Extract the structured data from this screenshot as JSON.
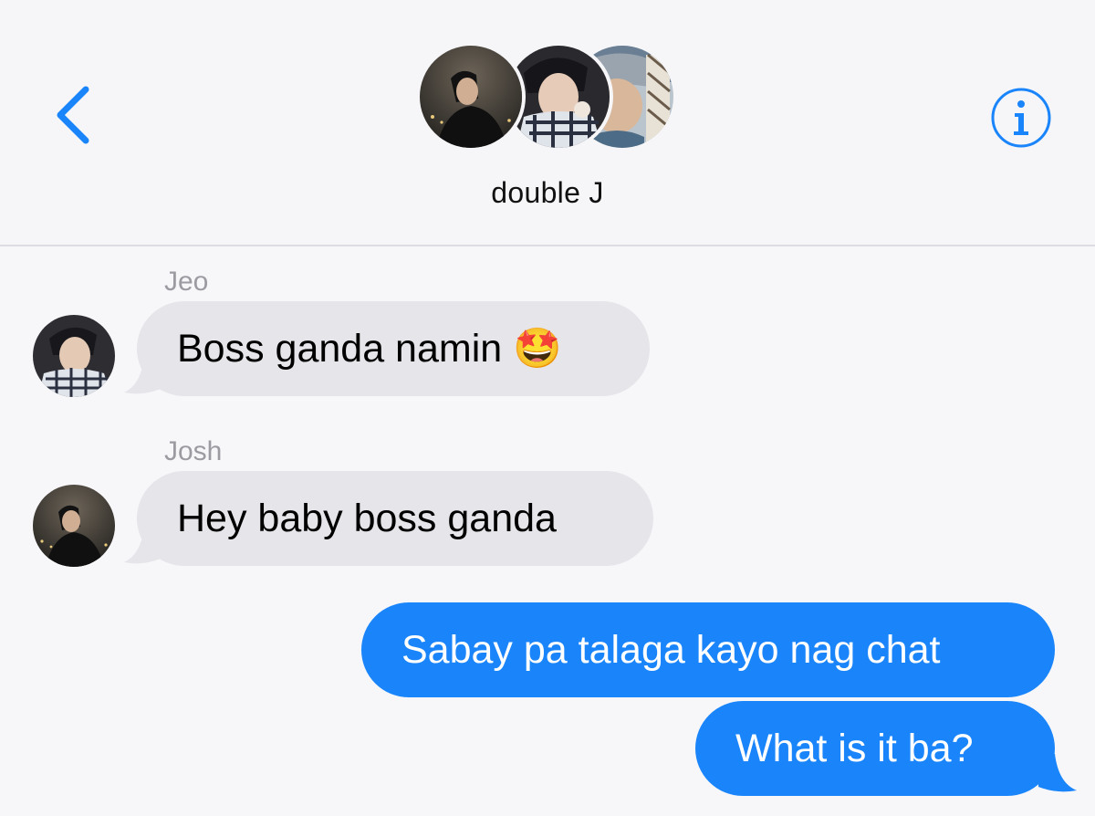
{
  "header": {
    "back_icon": "chevron-left-icon",
    "info_icon": "info-circle-icon",
    "group_name": "double J",
    "avatars": [
      "person-photo",
      "person-photo",
      "person-photo"
    ],
    "accent_color": "#1a85fb"
  },
  "messages": [
    {
      "direction": "incoming",
      "sender": "Jeo",
      "text": "Boss ganda namin 🤩"
    },
    {
      "direction": "incoming",
      "sender": "Josh",
      "text": "Hey baby boss ganda"
    },
    {
      "direction": "outgoing",
      "text": "Sabay pa talaga kayo nag chat"
    },
    {
      "direction": "outgoing",
      "text": "What is it ba?"
    }
  ],
  "colors": {
    "incoming_bubble": "#e5e5ea",
    "outgoing_bubble": "#1a85fb",
    "sender_label": "#9b9ba1"
  }
}
